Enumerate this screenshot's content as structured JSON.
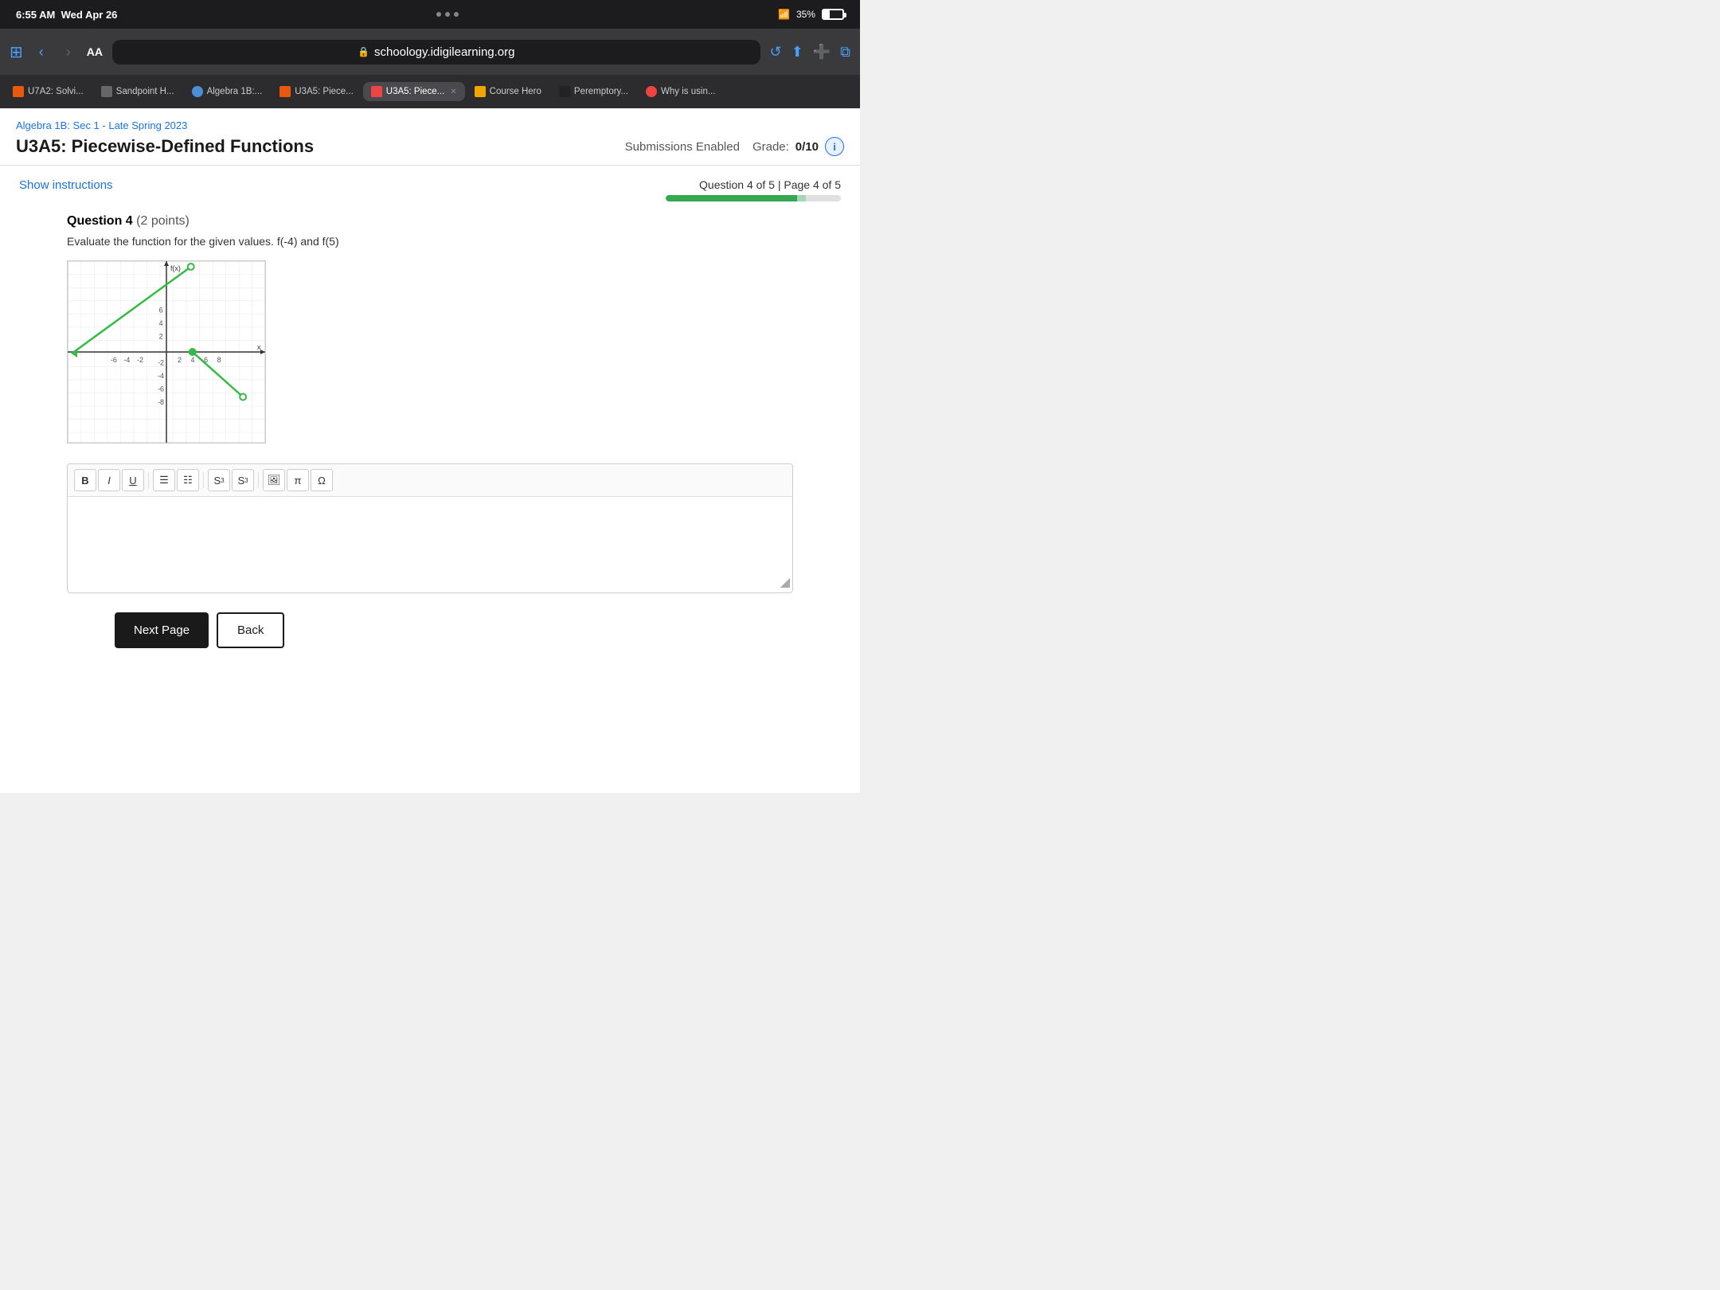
{
  "statusBar": {
    "time": "6:55 AM",
    "date": "Wed Apr 26",
    "battery": "35%"
  },
  "browser": {
    "urlDisplay": "schoology.idigilearning.org",
    "aa_label": "AA"
  },
  "tabs": [
    {
      "id": "t1",
      "label": "U7A2: Solvi...",
      "favicon_color": "#e8590c",
      "active": false,
      "closeable": false
    },
    {
      "id": "t2",
      "label": "Sandpoint H...",
      "favicon_color": "#666",
      "active": false,
      "closeable": false
    },
    {
      "id": "t3",
      "label": "Algebra 1B:...",
      "favicon_color": "#4a90d9",
      "active": false,
      "closeable": false
    },
    {
      "id": "t4",
      "label": "U3A5: Piece...",
      "favicon_color": "#e8590c",
      "active": false,
      "closeable": false
    },
    {
      "id": "t5",
      "label": "U3A5: Piece...",
      "favicon_color": "#e44",
      "active": true,
      "closeable": true
    },
    {
      "id": "t6",
      "label": "Course Hero",
      "favicon_color": "#f0a500",
      "active": false,
      "closeable": false
    },
    {
      "id": "t7",
      "label": "Peremptory...",
      "favicon_color": "#222",
      "active": false,
      "closeable": false
    },
    {
      "id": "t8",
      "label": "Why is usin...",
      "favicon_color": "#e44",
      "active": false,
      "closeable": false
    }
  ],
  "page": {
    "breadcrumb": "Algebra 1B: Sec 1 - Late Spring 2023",
    "title": "U3A5: Piecewise-Defined Functions",
    "submissionsLabel": "Submissions Enabled",
    "gradeLabel": "Grade:",
    "gradeValue": "0/10",
    "infoLabel": "i"
  },
  "quiz": {
    "showInstructionsLabel": "Show instructions",
    "progressLabel": "Question 4 of 5 | Page 4 of 5",
    "progressFilled": 75,
    "progressCurrent": 5,
    "questionNumber": "Question 4",
    "questionPoints": "(2 points)",
    "questionText": "Evaluate the function for the given values. f(-4) and f(5)",
    "editorToolbar": {
      "bold": "B",
      "italic": "I",
      "underline": "U",
      "unorderedList": "≡",
      "orderedList": "≡↑",
      "superscript": "S³",
      "subscript": "S₃",
      "image": "🖼",
      "pi": "π",
      "omega": "Ω"
    },
    "nextPageLabel": "Next Page",
    "backLabel": "Back"
  }
}
